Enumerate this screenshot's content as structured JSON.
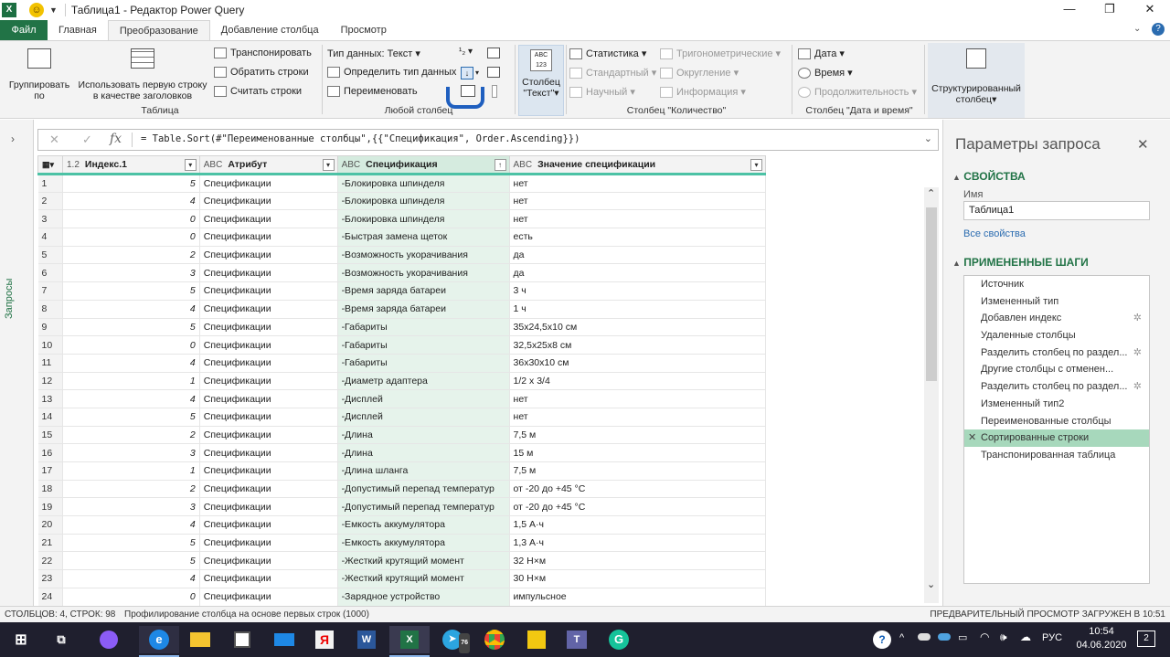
{
  "window": {
    "title": "Таблица1 - Редактор Power Query",
    "excel_logo": "X"
  },
  "tabs": [
    "Файл",
    "Главная",
    "Преобразование",
    "Добавление столбца",
    "Просмотр"
  ],
  "ribbon": {
    "group_table": {
      "label": "Таблица",
      "group_by": "Группировать по",
      "use_first_row": "Использовать первую строку в качестве заголовков",
      "transpose": "Транспонировать",
      "reverse_rows": "Обратить строки",
      "count_rows": "Считать строки"
    },
    "group_any_column": {
      "label": "Любой столбец",
      "data_type": "Тип данных: Текст",
      "detect_type": "Определить тип данных",
      "rename": "Переименовать"
    },
    "group_text_column": {
      "text_column": "Столбец \"Текст\""
    },
    "group_number_column": {
      "label": "Столбец \"Количество\"",
      "statistics": "Статистика",
      "standard": "Стандартный",
      "scientific": "Научный",
      "trig": "Тригонометрические",
      "rounding": "Округление",
      "information": "Информация"
    },
    "group_datetime": {
      "label": "Столбец \"Дата и время\"",
      "date": "Дата",
      "time": "Время",
      "duration": "Продолжительность"
    },
    "structured_column": "Структурированный столбец"
  },
  "left_panel": {
    "label": "Запросы"
  },
  "formula": "= Table.Sort(#\"Переименованные столбцы\",{{\"Спецификация\", Order.Ascending}})",
  "grid": {
    "columns": [
      {
        "type": "1.2",
        "name": "Индекс.1"
      },
      {
        "type": "ABC",
        "name": "Атрибут"
      },
      {
        "type": "ABC",
        "name": "Спецификация"
      },
      {
        "type": "ABC",
        "name": "Значение спецификации"
      }
    ],
    "rows": [
      [
        1,
        5,
        "Спецификации",
        "-Блокировка шпинделя",
        "нет"
      ],
      [
        2,
        4,
        "Спецификации",
        "-Блокировка шпинделя",
        "нет"
      ],
      [
        3,
        0,
        "Спецификации",
        "-Блокировка шпинделя",
        "нет"
      ],
      [
        4,
        0,
        "Спецификации",
        "-Быстрая замена щеток",
        "есть"
      ],
      [
        5,
        2,
        "Спецификации",
        "-Возможность укорачивания",
        "да"
      ],
      [
        6,
        3,
        "Спецификации",
        "-Возможность укорачивания",
        "да"
      ],
      [
        7,
        5,
        "Спецификации",
        "-Время заряда батареи",
        "3 ч"
      ],
      [
        8,
        4,
        "Спецификации",
        "-Время заряда батареи",
        "1 ч"
      ],
      [
        9,
        5,
        "Спецификации",
        "-Габариты",
        "35x24,5x10 см"
      ],
      [
        10,
        0,
        "Спецификации",
        "-Габариты",
        "32,5x25x8 см"
      ],
      [
        11,
        4,
        "Спецификации",
        "-Габариты",
        "36x30x10 см"
      ],
      [
        12,
        1,
        "Спецификации",
        "-Диаметр адаптера",
        "1/2 x 3/4"
      ],
      [
        13,
        4,
        "Спецификации",
        "-Дисплей",
        "нет"
      ],
      [
        14,
        5,
        "Спецификации",
        "-Дисплей",
        "нет"
      ],
      [
        15,
        2,
        "Спецификации",
        "-Длина",
        "7,5 м"
      ],
      [
        16,
        3,
        "Спецификации",
        "-Длина",
        "15 м"
      ],
      [
        17,
        1,
        "Спецификации",
        "-Длина шланга",
        "7,5 м"
      ],
      [
        18,
        2,
        "Спецификации",
        "-Допустимый перепад температур",
        "от -20 до +45 °C"
      ],
      [
        19,
        3,
        "Спецификации",
        "-Допустимый перепад температур",
        "от -20 до +45 °C"
      ],
      [
        20,
        4,
        "Спецификации",
        "-Емкость аккумулятора",
        "1,5 А·ч"
      ],
      [
        21,
        5,
        "Спецификации",
        "-Емкость аккумулятора",
        "1,3 А·ч"
      ],
      [
        22,
        5,
        "Спецификации",
        "-Жесткий крутящий момент",
        "32 Н×м"
      ],
      [
        23,
        4,
        "Спецификации",
        "-Жесткий крутящий момент",
        "30 Н×м"
      ],
      [
        24,
        0,
        "Спецификации",
        "-Зарядное устройство",
        "импульсное"
      ]
    ]
  },
  "query_pane": {
    "title": "Параметры запроса",
    "properties": "СВОЙСТВА",
    "name_label": "Имя",
    "name_value": "Таблица1",
    "all_properties": "Все свойства",
    "applied_steps": "ПРИМЕНЕННЫЕ ШАГИ",
    "steps": [
      {
        "label": "Источник",
        "gear": false
      },
      {
        "label": "Измененный тип",
        "gear": false
      },
      {
        "label": "Добавлен индекс",
        "gear": true
      },
      {
        "label": "Удаленные столбцы",
        "gear": false
      },
      {
        "label": "Разделить столбец по раздел...",
        "gear": true
      },
      {
        "label": "Другие столбцы с отменен...",
        "gear": false
      },
      {
        "label": "Разделить столбец по раздел...",
        "gear": true
      },
      {
        "label": "Измененный тип2",
        "gear": false
      },
      {
        "label": "Переименованные столбцы",
        "gear": false
      },
      {
        "label": "Сортированные строки",
        "gear": false,
        "selected": true
      },
      {
        "label": "Транспонированная таблица",
        "gear": false
      }
    ]
  },
  "status": {
    "left": "СТОЛБЦОВ: 4, СТРОК: 98",
    "profile": "Профилирование столбца на основе первых строк (1000)",
    "right": "ПРЕДВАРИТЕЛЬНЫЙ ПРОСМОТР ЗАГРУЖЕН В 10:51"
  },
  "taskbar": {
    "lang": "РУС",
    "time": "10:54",
    "date": "04.06.2020",
    "notifications": "2",
    "telegram_badge": "76"
  }
}
